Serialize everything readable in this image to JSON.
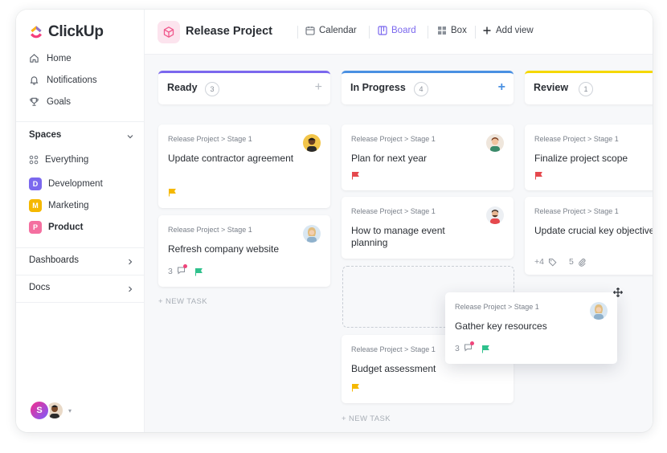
{
  "app": {
    "name": "ClickUp"
  },
  "nav": {
    "home": "Home",
    "notifications": "Notifications",
    "goals": "Goals"
  },
  "spaces": {
    "title": "Spaces",
    "everything": "Everything",
    "items": [
      {
        "letter": "D",
        "label": "Development",
        "color": "#7b68ee"
      },
      {
        "letter": "M",
        "label": "Marketing",
        "color": "#f5b800"
      },
      {
        "letter": "P",
        "label": "Product",
        "color": "#f46fa0"
      }
    ]
  },
  "dashboards": "Dashboards",
  "docs": "Docs",
  "user": {
    "initial": "S"
  },
  "header": {
    "project": "Release Project",
    "views": {
      "calendar": "Calendar",
      "board": "Board",
      "box": "Box",
      "add": "Add view"
    }
  },
  "columns": [
    {
      "title": "Ready",
      "count": "3",
      "color": "#7b68ee"
    },
    {
      "title": "In Progress",
      "count": "4",
      "color": "#4a90e2"
    },
    {
      "title": "Review",
      "count": "1",
      "color": "#f5d800"
    }
  ],
  "cards": {
    "c1": {
      "crumb": "Release Project > Stage 1",
      "title": "Update contractor agreement"
    },
    "c2": {
      "crumb": "Release Project > Stage 1",
      "title": "Refresh company website",
      "comments": "3"
    },
    "c3": {
      "crumb": "Release Project > Stage 1",
      "title": "Plan for next year"
    },
    "c4": {
      "crumb": "Release Project > Stage 1",
      "title": "How to manage event planning"
    },
    "c5": {
      "crumb": "Release Project > Stage 1",
      "title": "Budget assessment"
    },
    "c6": {
      "crumb": "Release Project > Stage 1",
      "title": "Finalize project scope"
    },
    "c7": {
      "crumb": "Release Project > Stage 1",
      "title": "Update crucial key objectives",
      "tags": "+4",
      "attachments": "5"
    },
    "drag": {
      "crumb": "Release Project > Stage 1",
      "title": "Gather key resources",
      "comments": "3"
    }
  },
  "new_task": "+ NEW TASK",
  "flag_colors": {
    "yellow": "#f5b800",
    "red": "#e5484d",
    "green": "#2fc18c"
  }
}
